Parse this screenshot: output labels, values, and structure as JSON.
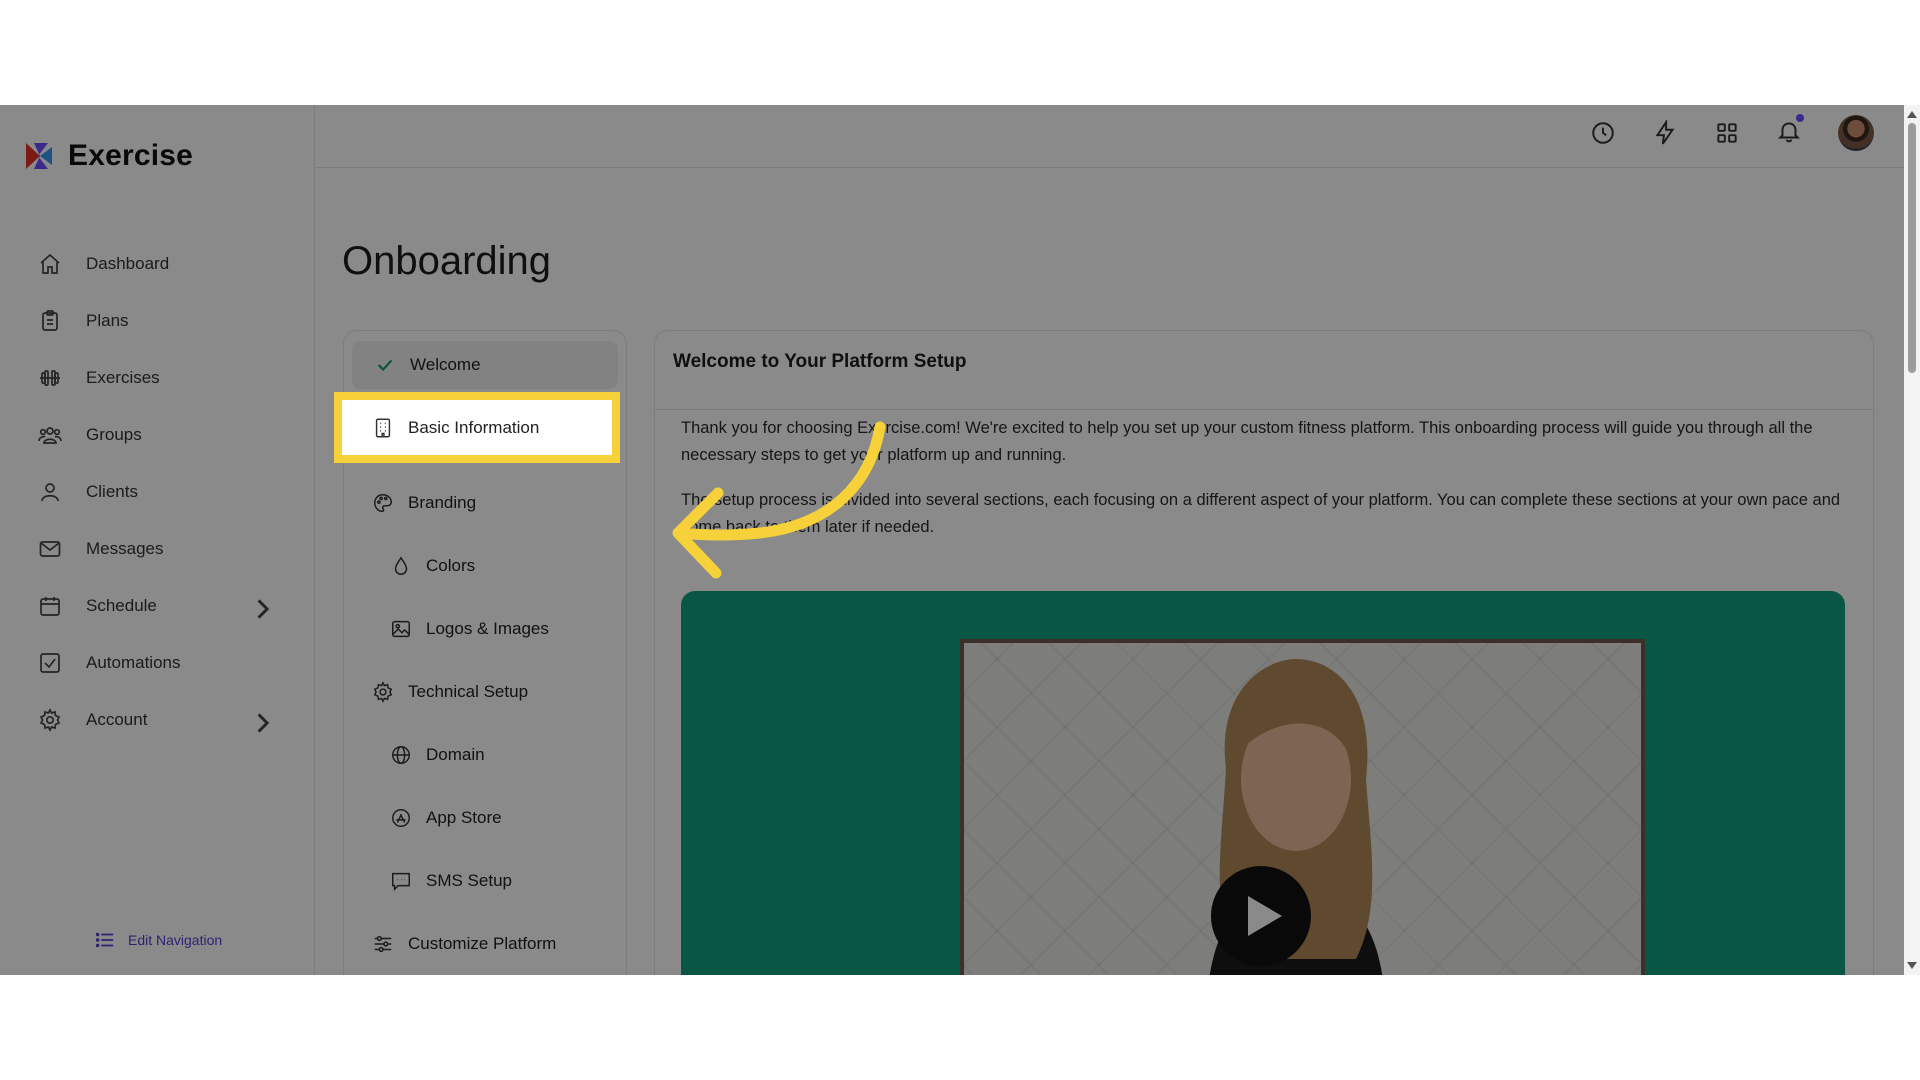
{
  "app": {
    "name": "Exercise"
  },
  "sidebar": {
    "items": [
      {
        "label": "Dashboard",
        "icon": "home-icon"
      },
      {
        "label": "Plans",
        "icon": "clipboard-icon"
      },
      {
        "label": "Exercises",
        "icon": "dumbbell-icon"
      },
      {
        "label": "Groups",
        "icon": "users-icon"
      },
      {
        "label": "Clients",
        "icon": "user-icon"
      },
      {
        "label": "Messages",
        "icon": "mail-icon"
      },
      {
        "label": "Schedule",
        "icon": "calendar-icon"
      },
      {
        "label": "Automations",
        "icon": "checkbox-icon"
      },
      {
        "label": "Account",
        "icon": "gear-icon"
      }
    ],
    "edit_label": "Edit Navigation"
  },
  "page": {
    "title": "Onboarding"
  },
  "steps": [
    {
      "label": "Welcome",
      "icon": "check-icon"
    },
    {
      "label": "Basic Information",
      "icon": "building-icon"
    },
    {
      "label": "Branding",
      "icon": "palette-icon"
    },
    {
      "label": "Colors",
      "icon": "droplet-icon"
    },
    {
      "label": "Logos & Images",
      "icon": "image-icon"
    },
    {
      "label": "Technical Setup",
      "icon": "gear-icon"
    },
    {
      "label": "Domain",
      "icon": "globe-icon"
    },
    {
      "label": "App Store",
      "icon": "app-store-icon"
    },
    {
      "label": "SMS Setup",
      "icon": "message-icon"
    },
    {
      "label": "Customize Platform",
      "icon": "sliders-icon"
    }
  ],
  "content": {
    "title": "Welcome to Your Platform Setup",
    "paragraph1": "Thank you for choosing Exercise.com! We're excited to help you set up your custom fitness platform. This onboarding process will guide you through all the necessary steps to get your platform up and running.",
    "paragraph2": "The setup process is divided into several sections, each focusing on a different aspect of your platform. You can complete these sections at your own pace and come back to them later if needed."
  },
  "colors": {
    "highlight": "#f6d13a",
    "accent": "#5a3fd1",
    "video_bg": "#0f9f7d",
    "success": "#1a9e6b"
  }
}
